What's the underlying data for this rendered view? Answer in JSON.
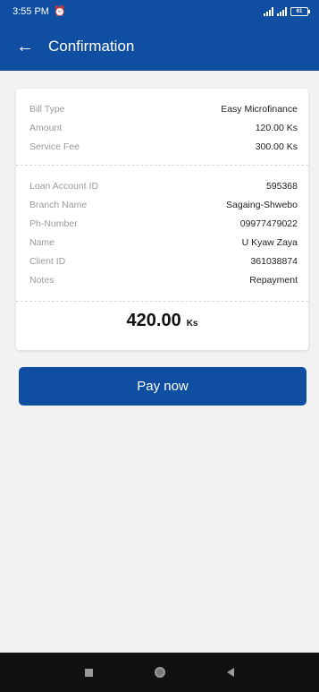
{
  "status_bar": {
    "time": "3:55 PM",
    "battery": "61"
  },
  "header": {
    "title": "Confirmation"
  },
  "bill": {
    "rows": [
      {
        "label": "Bill Type",
        "value": "Easy Microfinance"
      },
      {
        "label": "Amount",
        "value": "120.00 Ks"
      },
      {
        "label": "Service Fee",
        "value": "300.00 Ks"
      }
    ]
  },
  "account": {
    "rows": [
      {
        "label": "Loan Account ID",
        "value": "595368"
      },
      {
        "label": "Branch Name",
        "value": "Sagaing-Shwebo"
      },
      {
        "label": "Ph-Number",
        "value": "09977479022"
      },
      {
        "label": "Name",
        "value": "U Kyaw Zaya"
      },
      {
        "label": "Client ID",
        "value": "361038874"
      },
      {
        "label": "Notes",
        "value": "Repayment"
      }
    ]
  },
  "total": {
    "amount": "420.00",
    "unit": "Ks"
  },
  "actions": {
    "pay_label": "Pay now"
  },
  "colors": {
    "primary": "#0f4ea0",
    "background": "#f2f2f2"
  }
}
